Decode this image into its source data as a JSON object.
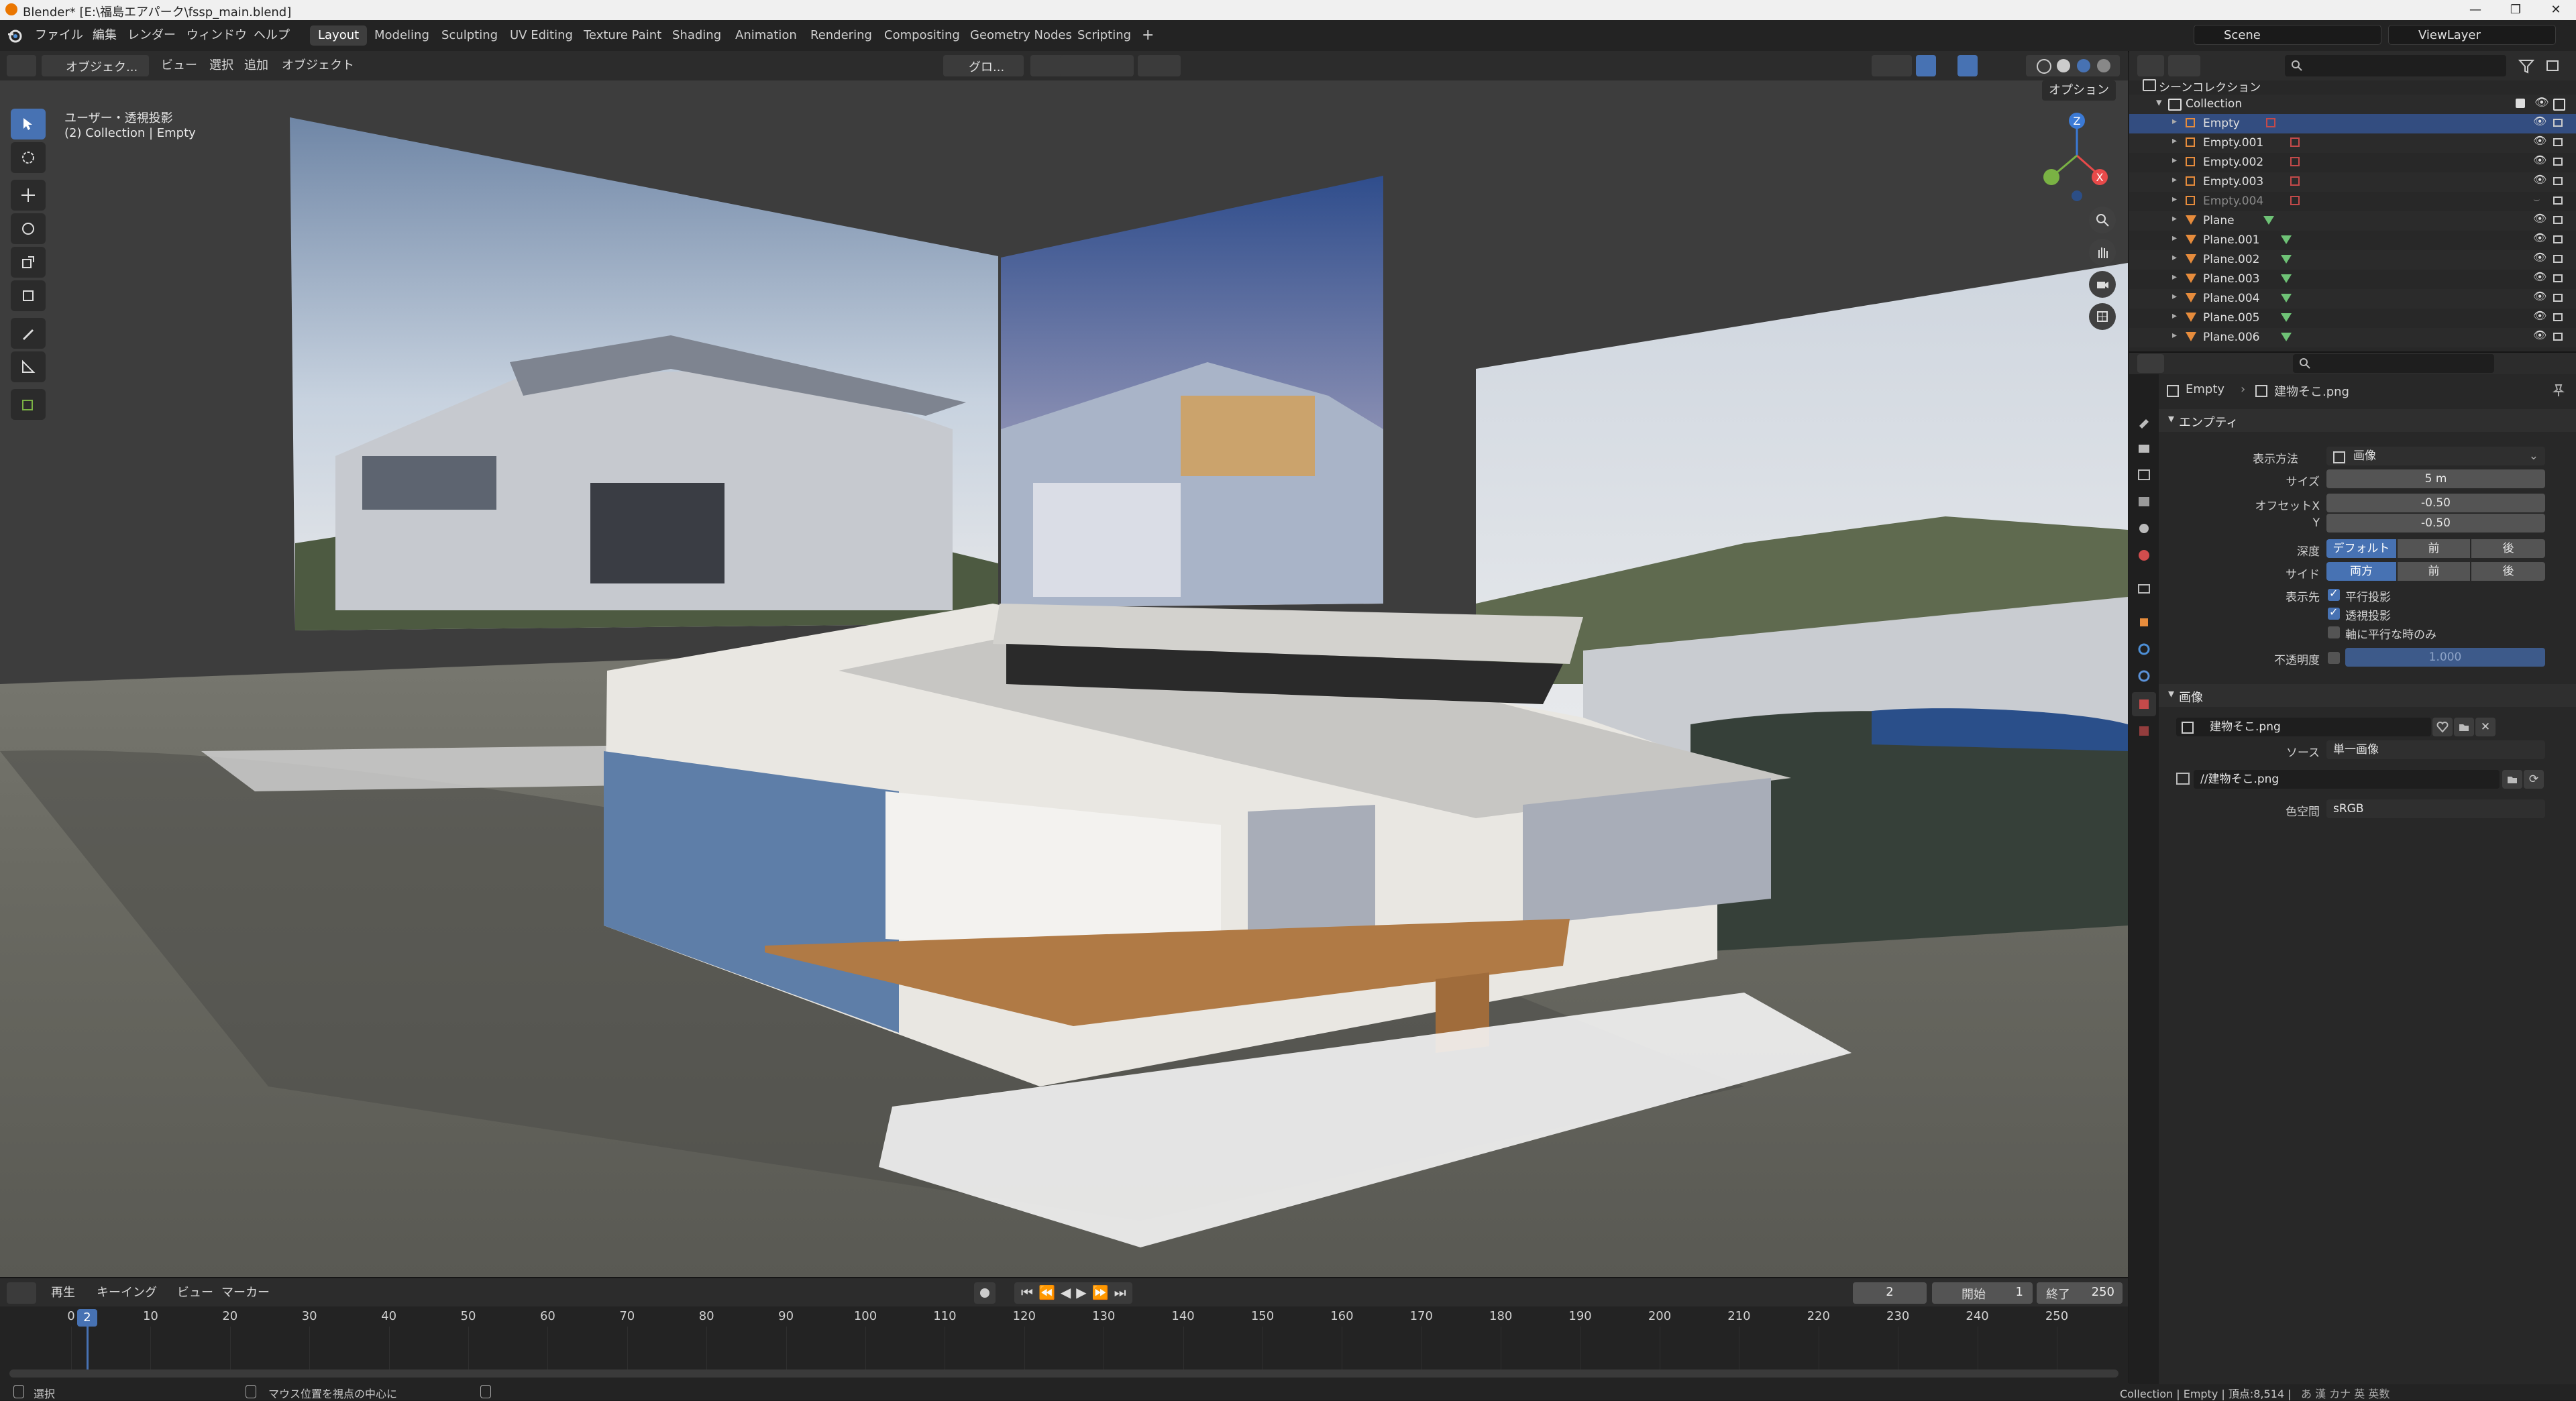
{
  "window": {
    "title": "Blender* [E:\\福島エアパーク\\fssp_main.blend]",
    "controls": [
      "—",
      "❐",
      "✕"
    ]
  },
  "menu": [
    "ファイル",
    "編集",
    "レンダー",
    "ウィンドウ",
    "ヘルプ"
  ],
  "workspaces": [
    "Layout",
    "Modeling",
    "Sculpting",
    "UV Editing",
    "Texture Paint",
    "Shading",
    "Animation",
    "Rendering",
    "Compositing",
    "Geometry Nodes",
    "Scripting"
  ],
  "workspace_add": "+",
  "scene": "Scene",
  "view_layer": "ViewLayer",
  "viewport_header": {
    "mode": "オブジェク...",
    "menus": [
      "ビュー",
      "選択",
      "追加",
      "オブジェクト"
    ],
    "transform_orientation": "グロ...",
    "options": "オプション"
  },
  "viewport_overlay": {
    "line1": "ユーザー・透視投影",
    "line2": "(2) Collection | Empty"
  },
  "gizmo": {
    "z": "Z",
    "x": "X"
  },
  "timeline": {
    "menus": [
      "再生",
      "キーイング",
      "ビュー",
      "マーカー"
    ],
    "current_frame": "2",
    "start_label": "開始",
    "start": "1",
    "end_label": "終了",
    "end": "250",
    "ticks": [
      "0",
      "10",
      "20",
      "30",
      "40",
      "50",
      "60",
      "70",
      "80",
      "90",
      "100",
      "110",
      "120",
      "130",
      "140",
      "150",
      "160",
      "170",
      "180",
      "190",
      "200",
      "210",
      "220",
      "230",
      "240",
      "250"
    ]
  },
  "status": {
    "left": "選択",
    "middle": "マウス位置を視点の中心に",
    "right": "Collection | Empty | 頂点:8,514 |",
    "ime": "あ 漢 カナ 英 英数"
  },
  "outliner": {
    "root": "シーンコレクション",
    "collection": "Collection",
    "items": [
      {
        "name": "Empty",
        "type": "empty",
        "selected": true
      },
      {
        "name": "Empty.001",
        "type": "empty"
      },
      {
        "name": "Empty.002",
        "type": "empty"
      },
      {
        "name": "Empty.003",
        "type": "empty"
      },
      {
        "name": "Empty.004",
        "type": "empty",
        "hidden": true
      },
      {
        "name": "Plane",
        "type": "mesh"
      },
      {
        "name": "Plane.001",
        "type": "mesh"
      },
      {
        "name": "Plane.002",
        "type": "mesh"
      },
      {
        "name": "Plane.003",
        "type": "mesh"
      },
      {
        "name": "Plane.004",
        "type": "mesh"
      },
      {
        "name": "Plane.005",
        "type": "mesh"
      },
      {
        "name": "Plane.006",
        "type": "mesh"
      }
    ]
  },
  "properties": {
    "breadcrumb_object": "Empty",
    "breadcrumb_data": "建物そこ.png",
    "empty_section": "エンプティ",
    "display_type_label": "表示方法",
    "display_type": "画像",
    "size_label": "サイズ",
    "size": "5 m",
    "offset_x_label": "オフセットX",
    "offset_x": "-0.50",
    "offset_y_label": "Y",
    "offset_y": "-0.50",
    "depth_label": "深度",
    "depth_options": [
      "デフォルト",
      "前",
      "後"
    ],
    "side_label": "サイド",
    "side_options": [
      "両方",
      "前",
      "後"
    ],
    "show_label": "表示先",
    "show_orthographic": "平行投影",
    "show_perspective": "透視投影",
    "show_axis_aligned": "軸に平行な時のみ",
    "opacity_label": "不透明度",
    "opacity": "1.000",
    "image_section": "画像",
    "image_name": "建物そこ.png",
    "source_label": "ソース",
    "source": "単一画像",
    "filepath": "//建物そこ.png",
    "colorspace_label": "色空間",
    "colorspace": "sRGB"
  },
  "colors": {
    "accent": "#4772b3",
    "selected_row": "#334d80",
    "object_orange": "#e78c3c",
    "mesh_green": "#6ec276",
    "gizmo_x": "#e84a4a",
    "gizmo_y": "#7ab244",
    "gizmo_z": "#3b7ad6"
  }
}
